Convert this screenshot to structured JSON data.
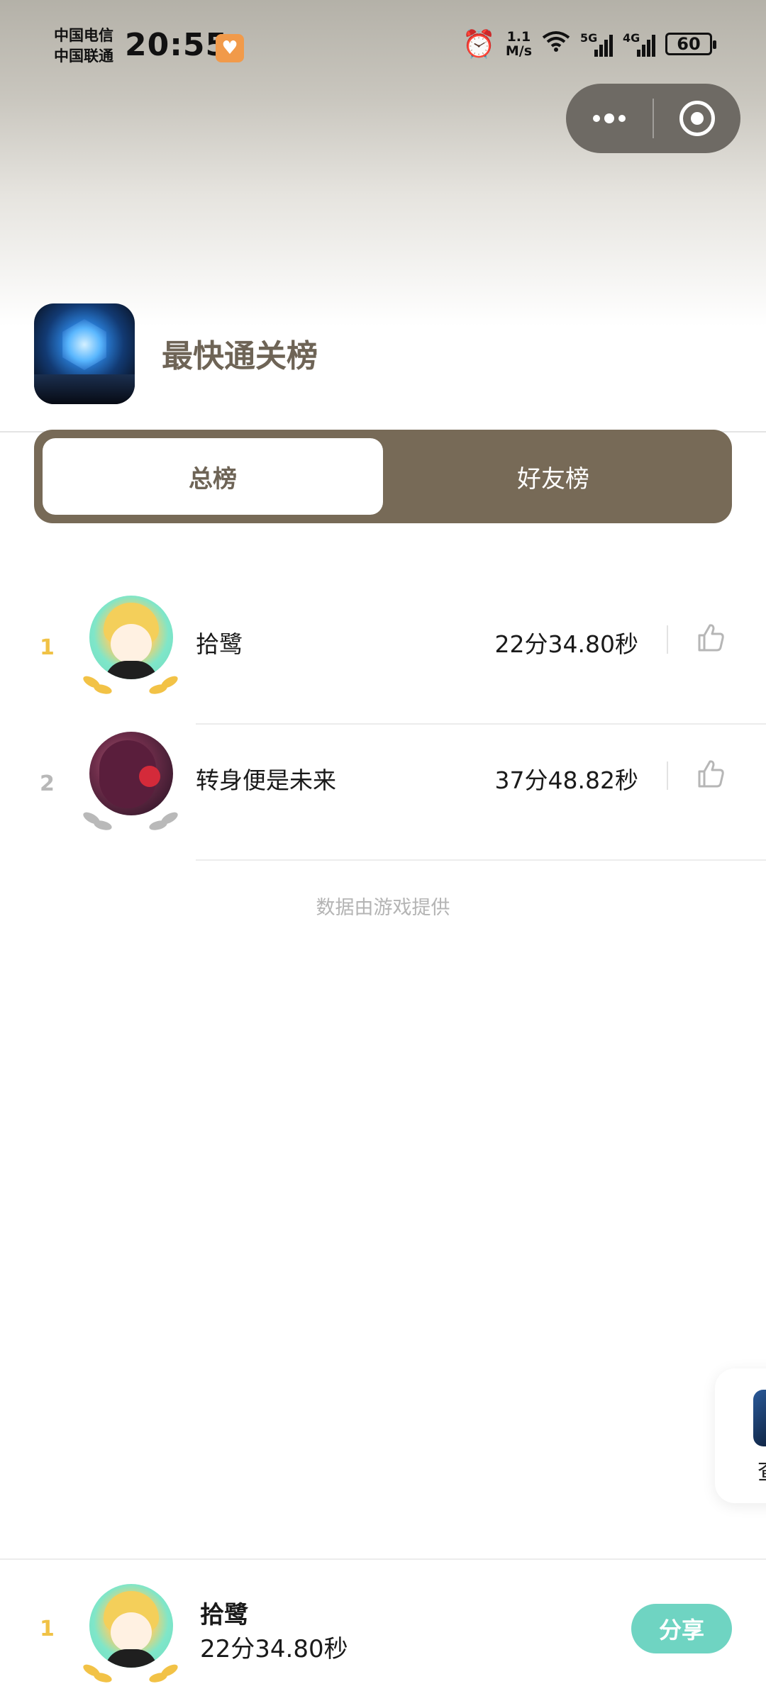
{
  "status_bar": {
    "carrier1": "中国电信",
    "carrier2": "中国联通",
    "time": "20:55",
    "speed_value": "1.1",
    "speed_unit": "M/s",
    "sim1_tag": "5G",
    "sim2_tag": "4G",
    "battery": "60"
  },
  "header": {
    "title": "最快通关榜"
  },
  "tabs": [
    {
      "label": "总榜",
      "active": true
    },
    {
      "label": "好友榜",
      "active": false
    }
  ],
  "leaderboard": [
    {
      "rank": "1",
      "name": "拾鹭",
      "time": "22分34.80秒"
    },
    {
      "rank": "2",
      "name": "转身便是未来",
      "time": "37分48.82秒"
    }
  ],
  "footer_note": "数据由游戏提供",
  "side_card": {
    "text": "查"
  },
  "me": {
    "rank": "1",
    "name": "拾鹭",
    "time": "22分34.80秒",
    "share_label": "分享"
  },
  "colors": {
    "accent_brown": "#776a57",
    "title_brown": "#6e6456",
    "share_teal": "#6fd4c2",
    "gold": "#f0c246",
    "silver": "#b8b8b8"
  }
}
